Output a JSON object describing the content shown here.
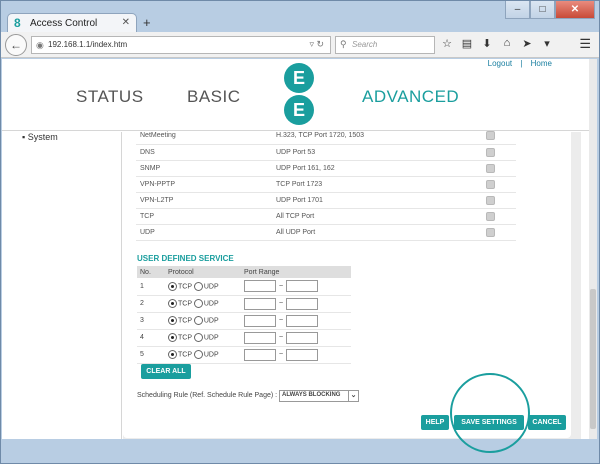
{
  "browser": {
    "tab_title": "Access Control",
    "tab_favicon": "8",
    "new_tab": "+",
    "url": "192.168.1.1/index.htm",
    "search_placeholder": "Search",
    "min": "–",
    "max": "□",
    "close": "✕"
  },
  "header": {
    "logout": "Logout",
    "separator": "|",
    "home": "Home",
    "nav": [
      "STATUS",
      "BASIC",
      "ADVANCED"
    ],
    "logo_letter": "E"
  },
  "sidebar": {
    "item": "▪ System"
  },
  "services": [
    {
      "name": "NetMeeting",
      "port": "H.323, TCP Port 1720, 1503"
    },
    {
      "name": "DNS",
      "port": "UDP Port 53"
    },
    {
      "name": "SNMP",
      "port": "UDP Port 161, 162"
    },
    {
      "name": "VPN-PPTP",
      "port": "TCP Port 1723"
    },
    {
      "name": "VPN-L2TP",
      "port": "UDP Port 1701"
    },
    {
      "name": "TCP",
      "port": "All TCP Port"
    },
    {
      "name": "UDP",
      "port": "All UDP Port"
    }
  ],
  "user_defined": {
    "title": "USER DEFINED SERVICE",
    "headers": [
      "No.",
      "Protocol",
      "Port Range"
    ],
    "tcp_label": "TCP",
    "udp_label": "UDP",
    "tilde": "~",
    "rows": [
      "1",
      "2",
      "3",
      "4",
      "5"
    ]
  },
  "buttons": {
    "clear_all": "CLEAR ALL",
    "help": "HELP",
    "save": "SAVE SETTINGS",
    "cancel": "CANCEL"
  },
  "schedule": {
    "label": "Scheduling Rule (Ref. Schedule Rule Page) :",
    "value": "ALWAYS BLOCKING"
  },
  "colors": {
    "accent": "#1a9e9e"
  }
}
